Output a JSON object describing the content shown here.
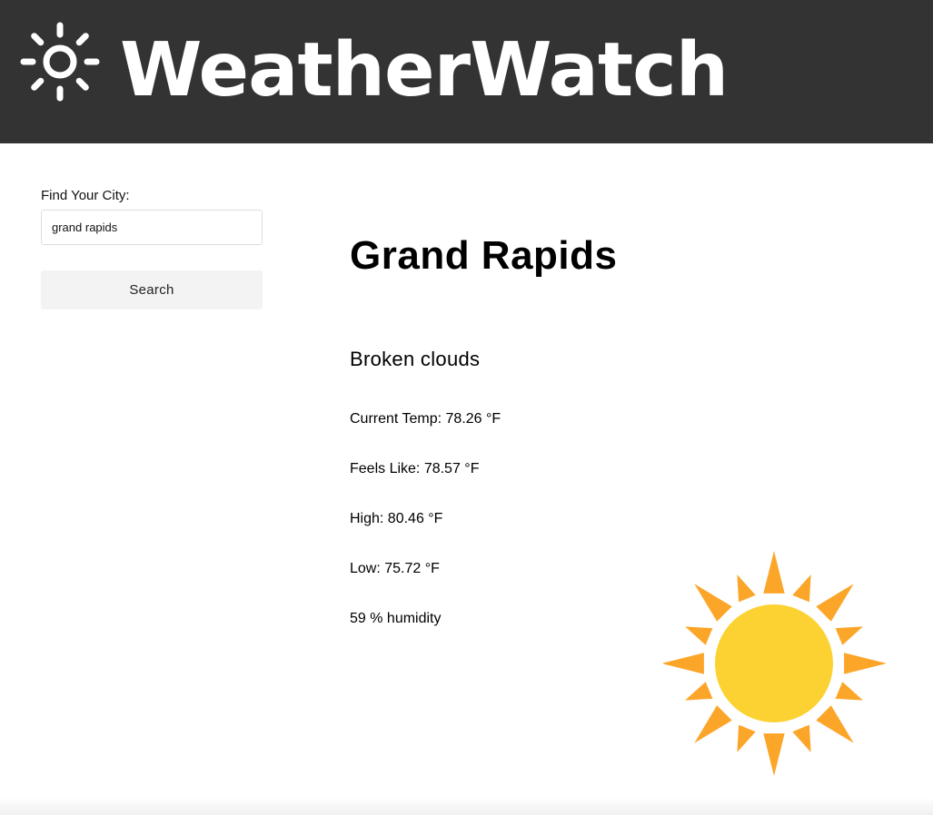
{
  "header": {
    "brand_name": "WeatherWatch",
    "logo_icon": "sun-icon"
  },
  "sidebar": {
    "search_label": "Find Your City:",
    "search_value": "grand rapids",
    "search_button_label": "Search"
  },
  "weather": {
    "city": "Grand Rapids",
    "description": "Broken clouds",
    "current_temp": "Current Temp: 78.26 °F",
    "feels_like": "Feels Like: 78.57 °F",
    "high": "High: 80.46 °F",
    "low": "Low: 75.72 °F",
    "humidity": "59 % humidity",
    "icon": "sun-icon"
  },
  "colors": {
    "header_bg": "#333333",
    "sun_core": "#fcd232",
    "sun_rays": "#fba629"
  }
}
